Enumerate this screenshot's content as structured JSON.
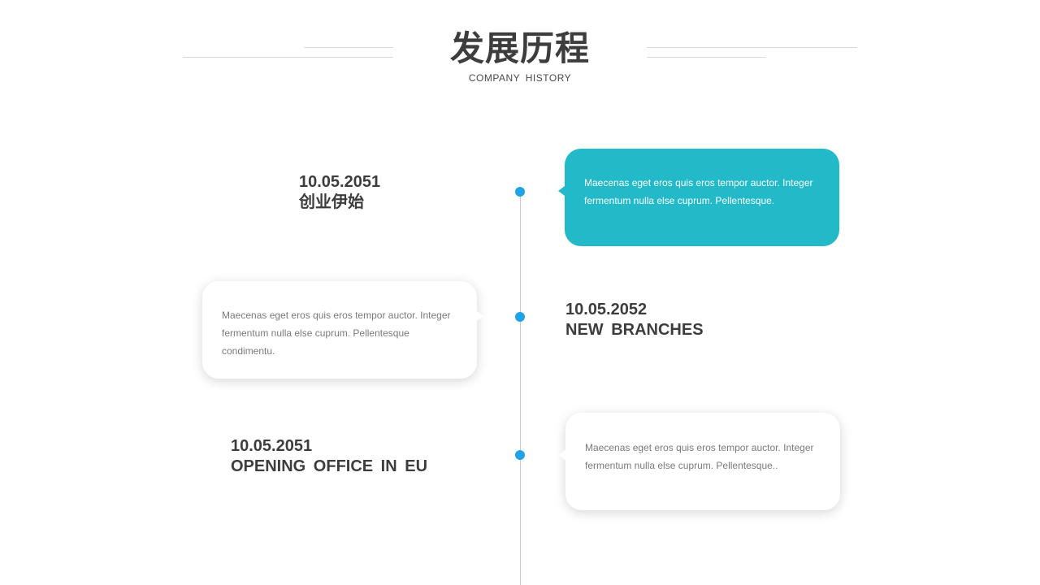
{
  "header": {
    "title": "发展历程",
    "subtitle": "COMPANY  HISTORY"
  },
  "colors": {
    "accent_teal": "#22b9c9",
    "dot_blue": "#1fa3e6",
    "text_dark": "#3d3d3d",
    "text_gray": "#7a7a7a"
  },
  "timeline": [
    {
      "date": "10.05.2051",
      "title": "创业伊始",
      "description": "Maecenas eget eros quis eros tempor auctor. Integer fermentum nulla else cuprum. Pellentesque."
    },
    {
      "date": "10.05.2052",
      "title": "NEW BRANCHES",
      "description": "Maecenas eget eros quis eros tempor auctor. Integer fermentum nulla else cuprum. Pellentesque condimentu."
    },
    {
      "date": "10.05.2051",
      "title": "OPENING OFFICE IN EU",
      "description": "Maecenas eget eros quis eros tempor auctor. Integer fermentum nulla else cuprum. Pellentesque.."
    }
  ]
}
